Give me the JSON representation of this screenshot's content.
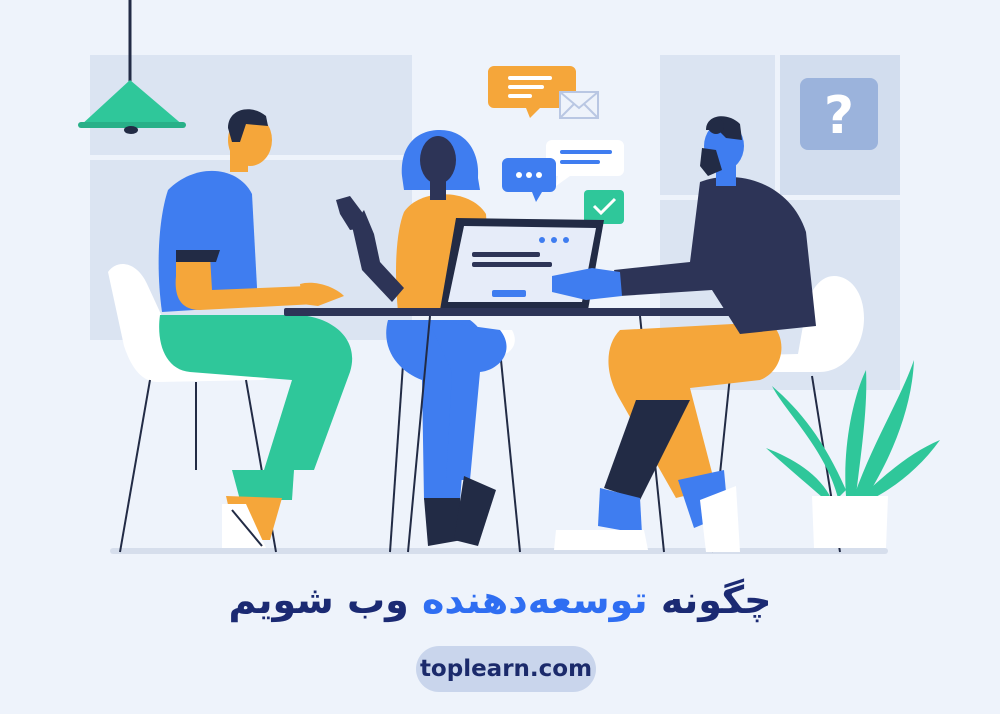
{
  "illustration": {
    "title_prefix": "چگونه",
    "title_highlight": "توسعه‌دهنده",
    "title_suffix": "وب شویم",
    "help_icon_glyph": "?",
    "website": "toplearn.com"
  },
  "colors": {
    "background": "#eef3fb",
    "title": "#1b2a73",
    "highlight": "#2f6ef2",
    "pill": "#c9d5ec"
  }
}
